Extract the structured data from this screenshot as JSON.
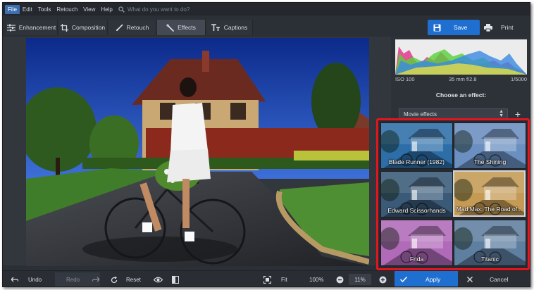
{
  "menu": {
    "items": [
      "File",
      "Edit",
      "Tools",
      "Retouch",
      "View",
      "Help"
    ],
    "search_placeholder": "What do you want to do?"
  },
  "toolbar": {
    "tabs": [
      "Enhancement",
      "Composition",
      "Retouch",
      "Effects",
      "Captions"
    ],
    "active_tab": "Effects",
    "save_label": "Save",
    "print_label": "Print"
  },
  "histogram": {
    "iso": "ISO 100",
    "lens": "35 mm f/2.8",
    "shutter": "1/5000"
  },
  "effects": {
    "heading": "Choose an effect:",
    "category": "Movie effects",
    "items": [
      {
        "label": "Blade Runner (1982)",
        "tint": "#2d6ea8"
      },
      {
        "label": "The Shining",
        "tint": "#6a8fc0"
      },
      {
        "label": "Edward Scissorhands",
        "tint": "#3a5a78"
      },
      {
        "label": "Mad Max: The Road of...",
        "tint": "#c49a55"
      },
      {
        "label": "Frida",
        "tint": "#b06ab8"
      },
      {
        "label": "Titanic",
        "tint": "#5f7fa0"
      }
    ],
    "selected_index": 3
  },
  "bottom": {
    "undo_label": "Undo",
    "redo_label": "Redo",
    "reset_label": "Reset",
    "fit_label": "Fit",
    "zoom_100": "100%",
    "zoom_value": "11%",
    "apply_label": "Apply",
    "cancel_label": "Cancel"
  },
  "colors": {
    "accent": "#1f6fd1",
    "highlight": "#e3161f"
  }
}
